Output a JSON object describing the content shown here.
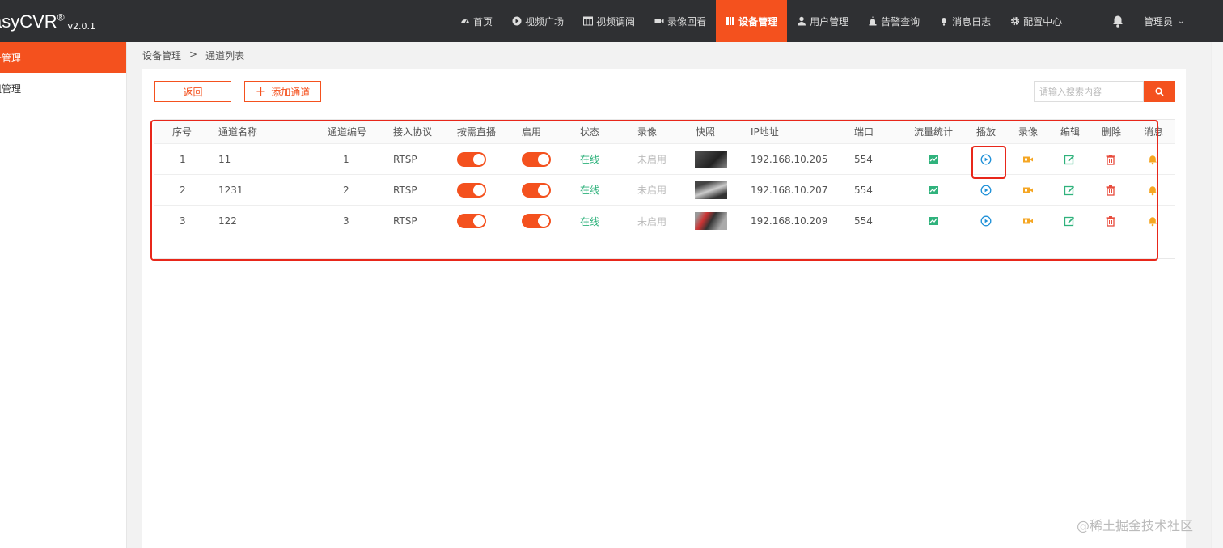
{
  "app": {
    "logo": "asyCVR",
    "logo_reg": "®",
    "version": "v2.0.1"
  },
  "nav": {
    "items": [
      {
        "label": "首页",
        "icon": "dashboard-icon"
      },
      {
        "label": "视频广场",
        "icon": "play-circle-icon"
      },
      {
        "label": "视频调阅",
        "icon": "grid-icon"
      },
      {
        "label": "录像回看",
        "icon": "video-icon"
      },
      {
        "label": "设备管理",
        "icon": "columns-icon"
      },
      {
        "label": "用户管理",
        "icon": "user-icon"
      },
      {
        "label": "告警查询",
        "icon": "alarm-icon"
      },
      {
        "label": "消息日志",
        "icon": "bell-icon"
      },
      {
        "label": "配置中心",
        "icon": "gear-icon"
      }
    ],
    "active_label": "设备管理",
    "admin": "管理员"
  },
  "sidebar": {
    "items": [
      {
        "label": "备管理"
      },
      {
        "label": "组管理"
      }
    ]
  },
  "breadcrumb": {
    "root": "设备管理",
    "sep": ">",
    "current": "通道列表"
  },
  "actions": {
    "back": "返回",
    "add": "添加通道",
    "search_placeholder": "请输入搜索内容"
  },
  "table": {
    "headers": [
      "序号",
      "通道名称",
      "通道编号",
      "接入协议",
      "按需直播",
      "启用",
      "状态",
      "录像",
      "快照",
      "IP地址",
      "端口",
      "流量统计",
      "播放",
      "录像",
      "编辑",
      "删除",
      "消息"
    ],
    "rows": [
      {
        "no": "1",
        "name": "11",
        "channel": "1",
        "protocol": "RTSP",
        "on_demand": true,
        "enabled": true,
        "status": "在线",
        "record": "未启用",
        "ip": "192.168.10.205",
        "port": "554"
      },
      {
        "no": "2",
        "name": "1231",
        "channel": "2",
        "protocol": "RTSP",
        "on_demand": true,
        "enabled": true,
        "status": "在线",
        "record": "未启用",
        "ip": "192.168.10.207",
        "port": "554"
      },
      {
        "no": "3",
        "name": "122",
        "channel": "3",
        "protocol": "RTSP",
        "on_demand": true,
        "enabled": true,
        "status": "在线",
        "record": "未启用",
        "ip": "192.168.10.209",
        "port": "554"
      }
    ]
  },
  "colors": {
    "accent": "#f4511e",
    "online": "#2fb27c",
    "play": "#1e90d8",
    "record": "#f5a623",
    "edit": "#2fb27c",
    "delete": "#e84c3d",
    "annotation": "#e8271a"
  },
  "watermark": "@稀土掘金技术社区"
}
